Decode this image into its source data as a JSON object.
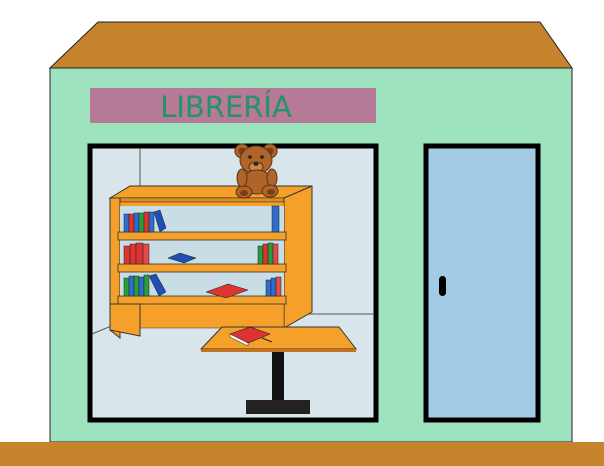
{
  "sign": {
    "label": "LIBRERÍA"
  },
  "icons": {
    "roof": "roof",
    "storefront": "bookstore-facade",
    "window": "shop-window",
    "door": "door",
    "shelf": "bookshelf",
    "teddy": "teddy-bear-icon",
    "table": "display-table",
    "ground": "sidewalk"
  },
  "colors": {
    "roof": "#c5832b",
    "wall": "#9ee3bf",
    "sign": "#b67a97",
    "sign_text": "#20946a",
    "window_bg": "#d8e6eb",
    "door": "#a3cbe6",
    "wood": "#f5a02a",
    "ground": "#c5832b"
  }
}
